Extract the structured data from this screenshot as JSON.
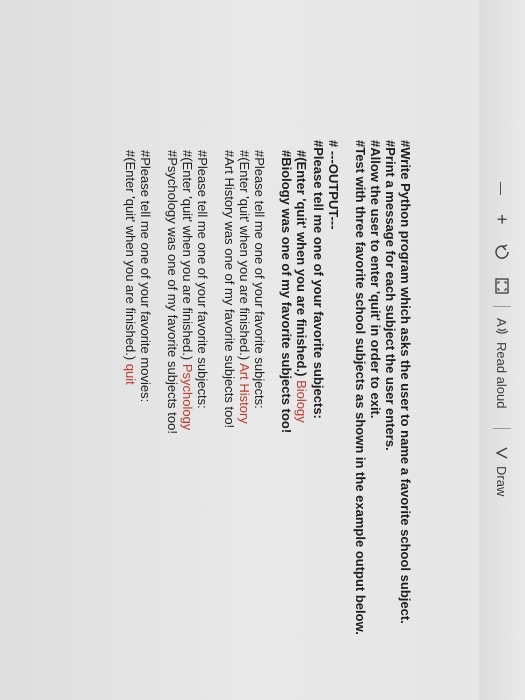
{
  "toolbar": {
    "zoom_out": "—",
    "zoom_in": "+",
    "read_aloud": "Read aloud",
    "draw": "Draw"
  },
  "document": {
    "lines": [
      "#Write Python program which asks the user to name a favorite school subject.",
      "#Print a message for each subject the user enters.",
      "#Allow the user to enter 'quit' in order to exit.",
      "#Test with three favorite school subjects as shown in the example output below."
    ],
    "output_header": "# ---OUTPUT---",
    "prompt_subjects": "#Please tell me one of your favorite subjects:",
    "enter_quit": "#(Enter 'quit' when you are finished.)",
    "answers": [
      "Biology",
      "Art History",
      "Psychology"
    ],
    "responses": [
      "#Biology was one of my favorite subjects too!",
      "#Art History was one of my favorite subjects too!",
      "#Psychology was one of my favorite subjects too!"
    ],
    "prompt_movies": "#Please tell me one of your favorite movies:",
    "enter_quit2": "#(Enter 'quit' when you are finished.)",
    "quit_answer": "quit"
  }
}
